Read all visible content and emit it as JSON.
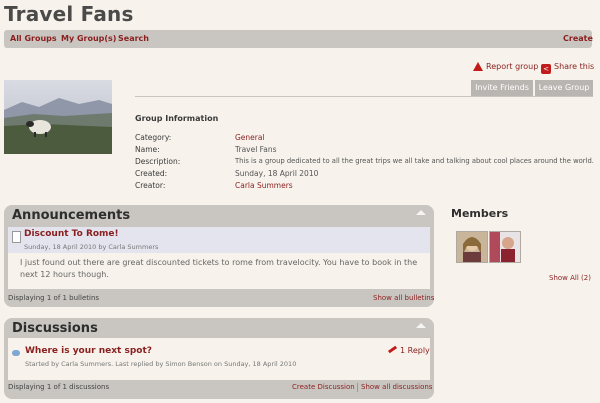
{
  "page_title": "Travel Fans",
  "nav": {
    "all_groups": "All Groups",
    "my_groups": "My Group(s)",
    "search": "Search",
    "create": "Create"
  },
  "actions": {
    "report_group": "Report group",
    "share_this": "Share this",
    "invite_friends": "Invite Friends",
    "leave_group": "Leave Group"
  },
  "group_info": {
    "heading": "Group Information",
    "rows": [
      {
        "label": "Category:",
        "value": "General"
      },
      {
        "label": "Name:",
        "value": "Travel Fans"
      },
      {
        "label": "Description:",
        "value": "This is a group dedicated to all the great trips we all take and talking about cool places around the world."
      },
      {
        "label": "Created:",
        "value": "Sunday, 18 April 2010"
      },
      {
        "label": "Creator:",
        "value": "Carla Summers"
      }
    ]
  },
  "announcements": {
    "title": "Announcements",
    "bulletin_title": "Discount To Rome!",
    "bulletin_meta": "Sunday, 18 April 2010 by Carla Summers",
    "bulletin_body": "I just found out there are great discounted tickets to rome from travelocity. You have to book in the next 12 hours though.",
    "footer_count": "Displaying 1 of 1 bulletins",
    "show_all": "Show all bulletins"
  },
  "members": {
    "title": "Members",
    "show_all": "Show All (2)"
  },
  "discussions": {
    "title": "Discussions",
    "topic_title": "Where is your next spot?",
    "topic_meta": "Started by Carla Summers. Last replied by Simon Benson on Sunday, 18 April 2010",
    "reply_count": "1 Reply",
    "footer_count": "Displaying 1 of 1 discussions",
    "create_discussion": "Create Discussion",
    "show_all": "Show all discussions"
  },
  "colors": {
    "accent": "#8a1f1f",
    "panel": "#c9c6c1",
    "background": "#f7f3ec"
  }
}
